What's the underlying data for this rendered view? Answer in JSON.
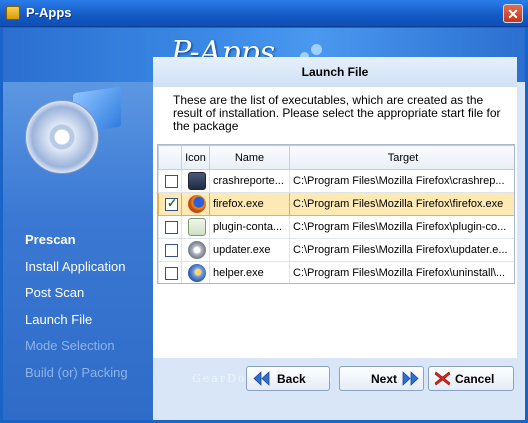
{
  "window": {
    "title": "P-Apps",
    "close_glyph": "✕"
  },
  "header": {
    "logo_text": "P-Apps"
  },
  "sidebar": {
    "steps": [
      {
        "label": "Prescan",
        "state": "active"
      },
      {
        "label": "Install Application",
        "state": "done"
      },
      {
        "label": "Post Scan",
        "state": "done"
      },
      {
        "label": "Launch File",
        "state": "done"
      },
      {
        "label": "Mode Selection",
        "state": "pending"
      },
      {
        "label": "Build (or) Packing",
        "state": "pending"
      }
    ]
  },
  "page": {
    "title": "Launch File",
    "description": "These are the list of executables, which are created as the result of installation. Please select the appropriate start file for the package"
  },
  "table": {
    "columns": [
      "",
      "Icon",
      "Name",
      "Target"
    ],
    "rows": [
      {
        "checked": false,
        "icon": "crash-reporter-icon",
        "name": "crashreporte...",
        "target": "C:\\Program Files\\Mozilla Firefox\\crashrep..."
      },
      {
        "checked": true,
        "icon": "firefox-icon",
        "name": "firefox.exe",
        "target": "C:\\Program Files\\Mozilla Firefox\\firefox.exe"
      },
      {
        "checked": false,
        "icon": "plugin-container-icon",
        "name": "plugin-conta...",
        "target": "C:\\Program Files\\Mozilla Firefox\\plugin-co..."
      },
      {
        "checked": false,
        "icon": "updater-icon",
        "name": "updater.exe",
        "target": "C:\\Program Files\\Mozilla Firefox\\updater.e..."
      },
      {
        "checked": false,
        "icon": "helper-icon",
        "name": "helper.exe",
        "target": "C:\\Program Files\\Mozilla Firefox\\uninstall\\..."
      }
    ]
  },
  "buttons": {
    "back": "Back",
    "next": "Next",
    "cancel": "Cancel"
  },
  "watermark": "GearDownload.com",
  "colors": {
    "accent": "#1a64c8",
    "selected_row": "#fde9b3",
    "cancel_icon": "#d8261b"
  }
}
